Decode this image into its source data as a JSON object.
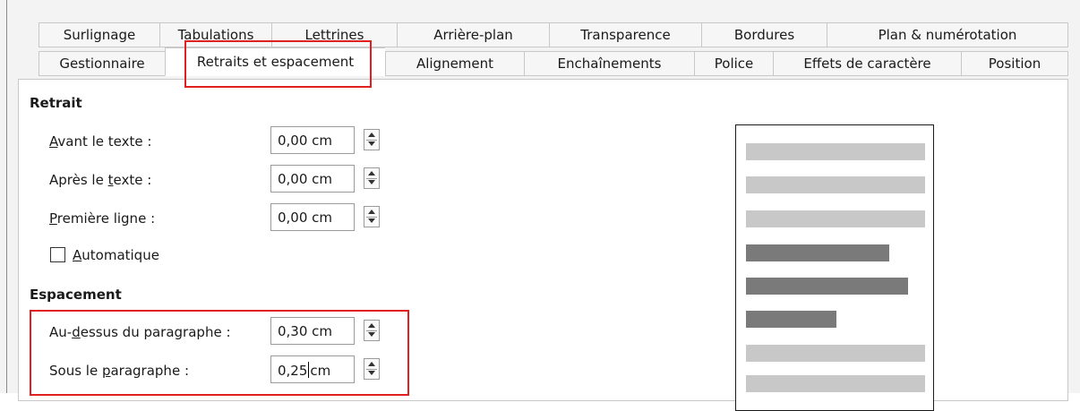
{
  "tabs_row1": [
    "Surlignage",
    "Tabulations",
    "Lettrines",
    "Arrière-plan",
    "Transparence",
    "Bordures",
    "Plan & numérotation"
  ],
  "tabs_row2": [
    "Gestionnaire",
    "Retraits et espacement",
    "Alignement",
    "Enchaînements",
    "Police",
    "Effets de caractère",
    "Position"
  ],
  "active_tab": "Retraits et espacement",
  "retrait": {
    "heading": "Retrait",
    "avant": {
      "mnemonic": "A",
      "rest": "vant le texte :",
      "value": "0,00 cm"
    },
    "apres": {
      "pre": "Après le ",
      "mnemonic": "t",
      "rest": "exte :",
      "value": "0,00 cm"
    },
    "premiere": {
      "mnemonic": "P",
      "rest": "remière ligne :",
      "value": "0,00 cm"
    },
    "auto": {
      "mnemonic": "A",
      "rest": "utomatique",
      "checked": false
    }
  },
  "espacement": {
    "heading": "Espacement",
    "dessus": {
      "pre": "Au-",
      "mnemonic": "d",
      "rest": "essus du paragraphe :",
      "value": "0,30 cm"
    },
    "sous": {
      "pre": "Sous le ",
      "mnemonic": "p",
      "rest": "aragraphe :",
      "value_before": "0,25",
      "value_after": "cm"
    }
  },
  "preview": {
    "light_color": "#c8c8c8",
    "dark_color": "#7a7a7a"
  },
  "highlight_color": "#e02020"
}
